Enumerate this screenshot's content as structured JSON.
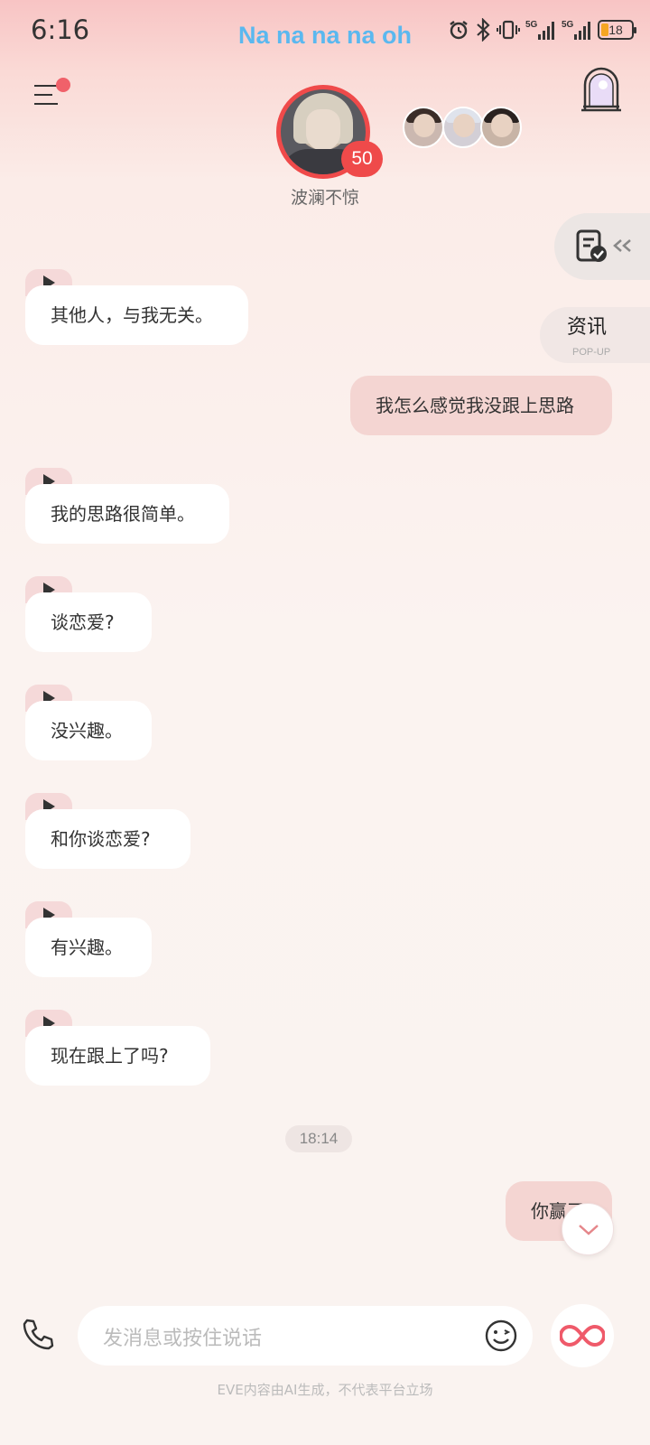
{
  "status_bar": {
    "time": "6:16",
    "now_playing": "Na na na na oh",
    "battery": "18"
  },
  "header": {
    "character_name": "波澜不惊",
    "intimacy": "50"
  },
  "side": {
    "news_title": "资讯",
    "news_sub": "POP-UP"
  },
  "messages": [
    {
      "from": "character",
      "text": "其他人，与我无关。",
      "voice": true
    },
    {
      "from": "user",
      "text": "我怎么感觉我没跟上思路"
    },
    {
      "from": "character",
      "text": "我的思路很简单。",
      "voice": true
    },
    {
      "from": "character",
      "text": "谈恋爱?",
      "voice": true
    },
    {
      "from": "character",
      "text": "没兴趣。",
      "voice": true
    },
    {
      "from": "character",
      "text": "和你谈恋爱?",
      "voice": true
    },
    {
      "from": "character",
      "text": "有兴趣。",
      "voice": true
    },
    {
      "from": "character",
      "text": "现在跟上了吗?",
      "voice": true
    },
    {
      "from": "user",
      "text": "你赢了"
    }
  ],
  "time_separator": "18:14",
  "composer": {
    "placeholder": "发消息或按住说话"
  },
  "disclaimer": "EVE内容由AI生成，不代表平台立场",
  "icons": [
    "menu-icon",
    "notification-dot",
    "gate-icon",
    "document-check-icon",
    "collapse-arrows-icon",
    "play-icon",
    "phone-icon",
    "emoji-icon",
    "infinity-icon",
    "chevron-down-icon"
  ]
}
